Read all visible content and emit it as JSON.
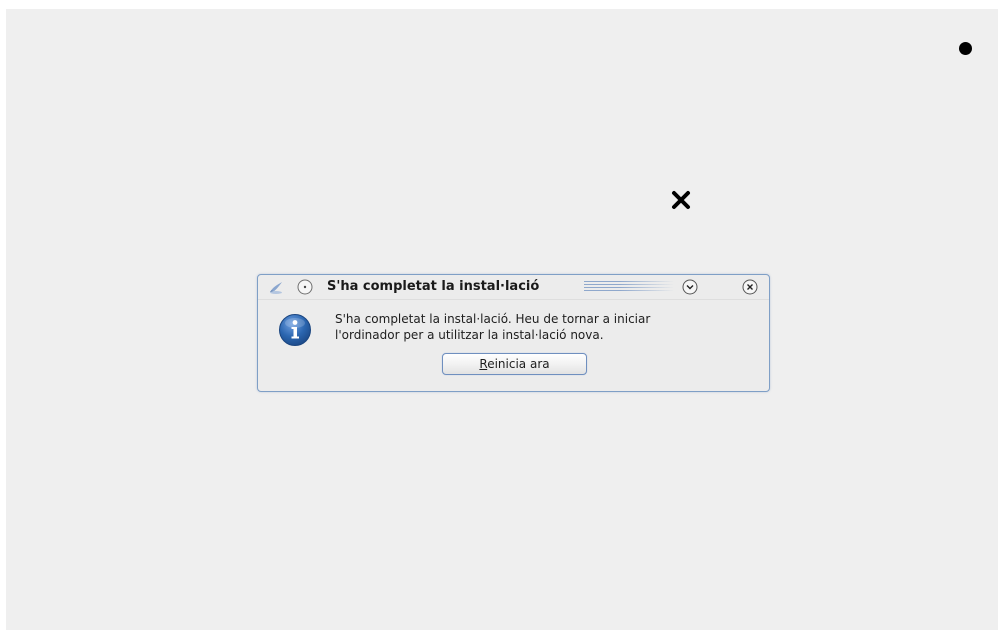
{
  "dialog": {
    "title": "S'ha completat la instal·lació",
    "message_line1": "S'ha completat la instal·lació. Heu de tornar a iniciar",
    "message_line2": "l'ordinador per a utilitzar la instal·lació nova.",
    "restart_button": {
      "mnemonic": "R",
      "label_rest": "einicia ara"
    },
    "icon": "information-icon"
  },
  "titlebar_icons": [
    "app-icon",
    "sticky-icon",
    "shade-icon",
    "close-icon"
  ],
  "cursors": [
    "dot-cursor",
    "x-cursor"
  ],
  "colors": {
    "desktop": "#efefef",
    "dialog_border": "#7f9fc6",
    "info_blue": "#2b66b0"
  }
}
